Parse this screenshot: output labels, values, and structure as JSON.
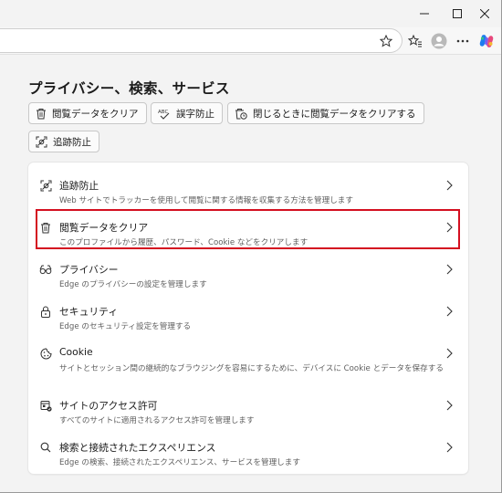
{
  "page": {
    "title": "プライバシー、検索、サービス"
  },
  "chips": [
    {
      "label": "閲覧データをクリア",
      "icon": "trash-icon"
    },
    {
      "label": "誤字防止",
      "icon": "spellcheck-icon"
    },
    {
      "label": "閉じるときに閲覧データをクリアする",
      "icon": "trash-clock-icon"
    },
    {
      "label": "追跡防止",
      "icon": "tracking-prevention-icon"
    }
  ],
  "settings": [
    {
      "title": "追跡防止",
      "desc": "Web サイトでトラッカーを使用して閲覧に関する情報を収集する方法を管理します",
      "icon": "tracking-prevention-icon"
    },
    {
      "title": "閲覧データをクリア",
      "desc": "このプロファイルから履歴、パスワード、Cookie などをクリアします",
      "icon": "trash-icon"
    },
    {
      "title": "プライバシー",
      "desc": "Edge のプライバシーの設定を管理します",
      "icon": "glasses-icon"
    },
    {
      "title": "セキュリティ",
      "desc": "Edge のセキュリティ設定を管理する",
      "icon": "lock-icon"
    },
    {
      "title": "Cookie",
      "desc": "サイトとセッション間の継続的なブラウジングを容易にするために、デバイスに Cookie とデータを保存する",
      "icon": "cookie-icon"
    },
    {
      "title": "サイトのアクセス許可",
      "desc": "すべてのサイトに適用されるアクセス許可を管理します",
      "icon": "site-permissions-icon"
    },
    {
      "title": "検索と接続されたエクスペリエンス",
      "desc": "Edge の検索、接続されたエクスペリエンス、サービスを管理します",
      "icon": "search-icon"
    }
  ],
  "colors": {
    "highlight": "#d40f20",
    "background": "#f3f3f3",
    "card": "#ffffff"
  }
}
